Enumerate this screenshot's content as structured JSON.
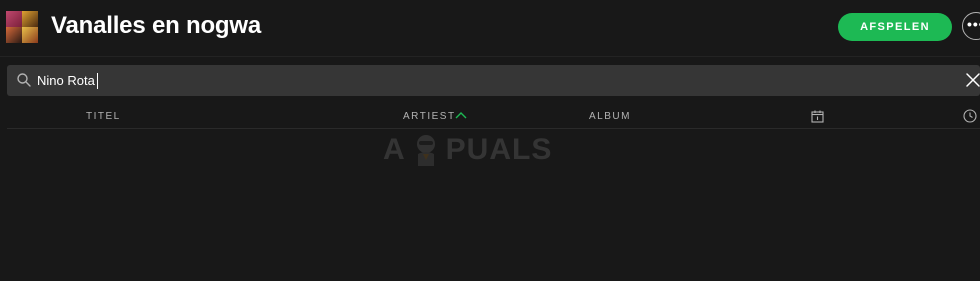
{
  "playlist": {
    "title": "Vanalles en nogwa",
    "play_label": "AFSPELEN",
    "more_label": "•••"
  },
  "search": {
    "value": "Nino Rota",
    "placeholder": ""
  },
  "columns": {
    "title": "TITEL",
    "artist": "ARTIEST",
    "album": "ALBUM"
  },
  "icons": {
    "search": "search-icon",
    "clear": "close-icon",
    "sort": "chevron-up-icon",
    "date": "calendar-icon",
    "duration": "clock-icon"
  },
  "watermark": {
    "text_a": "A",
    "text_rest": "PUALS"
  },
  "colors": {
    "background": "#181818",
    "accent": "#1db954",
    "search_bg": "#363636",
    "muted_text": "#b3b3b3"
  }
}
